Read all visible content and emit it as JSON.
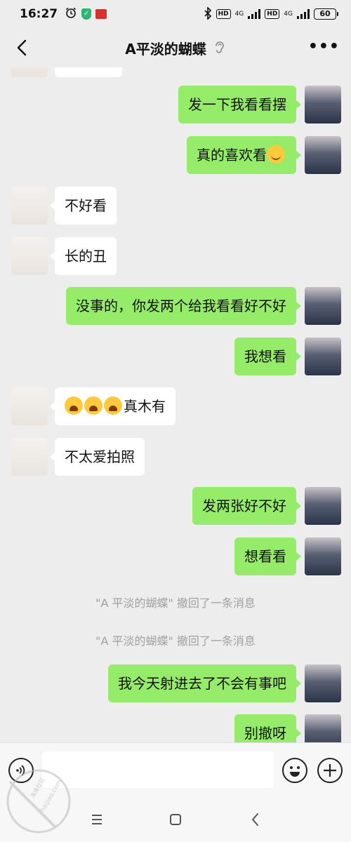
{
  "status_bar": {
    "time": "16:27",
    "network_left": "HD",
    "network_left_sub": "4G",
    "network_right": "HD",
    "network_right_sub": "4G",
    "battery": "60"
  },
  "header": {
    "title": "A平淡的蝴蝶",
    "back_icon": "chevron-left-icon",
    "voice_mode_icon": "ear-icon",
    "more_icon": "more-icon",
    "more_label": "•••"
  },
  "messages": [
    {
      "side": "out",
      "text": "发一下我看看摆"
    },
    {
      "side": "out",
      "text": "真的喜欢看",
      "emoji": [
        "smile"
      ]
    },
    {
      "side": "in",
      "text": "不好看"
    },
    {
      "side": "in",
      "text": "长的丑"
    },
    {
      "side": "out",
      "text": "没事的，你发两个给我看看好不好"
    },
    {
      "side": "out",
      "text": "我想看"
    },
    {
      "side": "in",
      "text": "真木有",
      "emoji_prefix": [
        "cry",
        "cry",
        "cry"
      ]
    },
    {
      "side": "in",
      "text": "不太爱拍照"
    },
    {
      "side": "out",
      "text": "发两张好不好"
    },
    {
      "side": "out",
      "text": "想看看"
    },
    {
      "side": "system",
      "text": "\"A 平淡的蝴蝶\" 撤回了一条消息"
    },
    {
      "side": "system",
      "text": "\"A 平淡的蝴蝶\" 撤回了一条消息"
    },
    {
      "side": "out",
      "text": "我今天射进去了不会有事吧"
    },
    {
      "side": "out",
      "text": "别撤呀"
    }
  ],
  "input_bar": {
    "voice_icon": "voice-icon",
    "emoji_icon": "emoji-icon",
    "plus_icon": "plus-icon",
    "value": ""
  },
  "watermark": {
    "text": "海角社区",
    "url_text": "haijiao.com"
  }
}
